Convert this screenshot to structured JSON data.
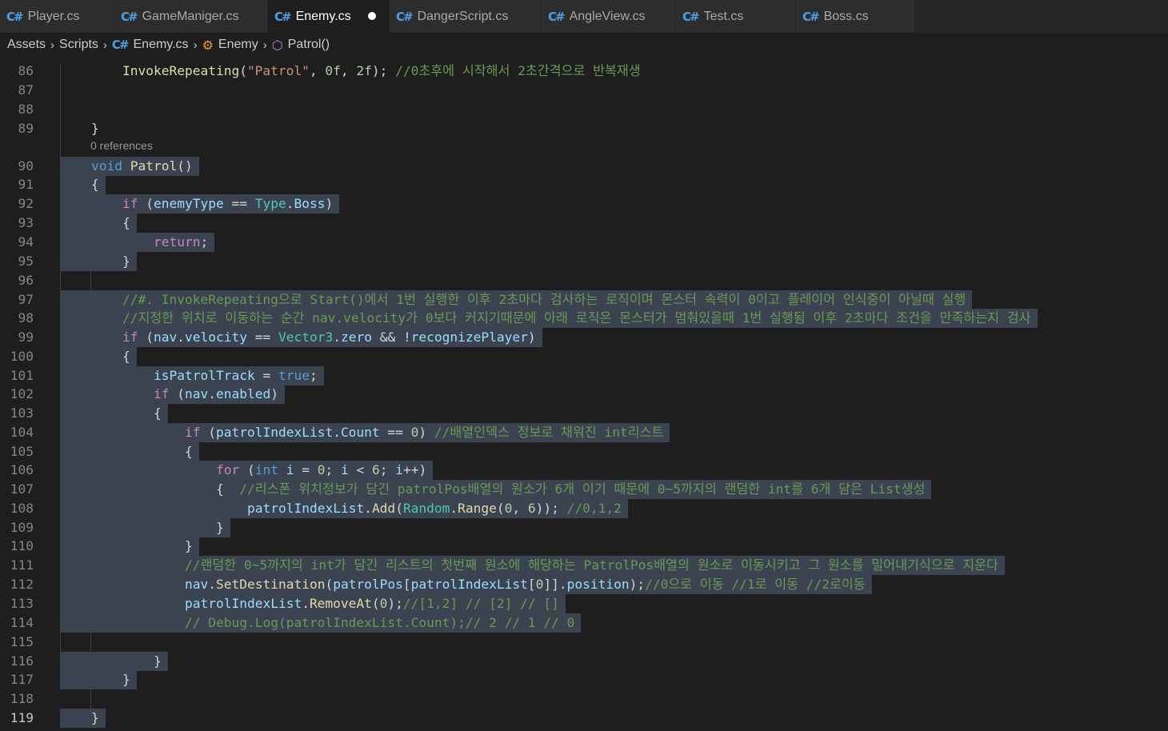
{
  "tabs": [
    {
      "label": "Player.cs",
      "active": false
    },
    {
      "label": "GameManiger.cs",
      "active": false
    },
    {
      "label": "Enemy.cs",
      "active": true,
      "modified": true
    },
    {
      "label": "DangerScript.cs",
      "active": false
    },
    {
      "label": "AngleView.cs",
      "active": false
    },
    {
      "label": "Test.cs",
      "active": false
    },
    {
      "label": "Boss.cs",
      "active": false
    }
  ],
  "breadcrumb": {
    "folder1": "Assets",
    "folder2": "Scripts",
    "file": "Enemy.cs",
    "class": "Enemy",
    "method": "Patrol()"
  },
  "codelens": "0 references",
  "colors": {
    "background": "#1e1e1e",
    "keyword": "#569cd6",
    "control": "#c586c0",
    "function": "#dcdcaa",
    "string": "#ce9178",
    "number": "#b5cea8",
    "variable": "#9cdcfe",
    "type": "#4ec9b0",
    "comment": "#6a9955",
    "selection": "#3b4350"
  },
  "lines": [
    {
      "n": "86",
      "code": "        InvokeRepeating(\"Patrol\", 0f, 2f); //0초후에 시작해서 2초간격으로 반복재생"
    },
    {
      "n": "87",
      "code": ""
    },
    {
      "n": "88",
      "code": ""
    },
    {
      "n": "89",
      "code": "    }"
    },
    {
      "n": "90",
      "code": "    void Patrol()"
    },
    {
      "n": "91",
      "code": "    {"
    },
    {
      "n": "92",
      "code": "        if (enemyType == Type.Boss)"
    },
    {
      "n": "93",
      "code": "        {"
    },
    {
      "n": "94",
      "code": "            return;"
    },
    {
      "n": "95",
      "code": "        }"
    },
    {
      "n": "96",
      "code": ""
    },
    {
      "n": "97",
      "code": "        //#. InvokeRepeating으로 Start()에서 1번 실행한 이후 2초마다 검사하는 로직이며 몬스터 속력이 0이고 플레이어 인식중이 아닐때 실행"
    },
    {
      "n": "98",
      "code": "        //지정한 위치로 이동하는 순간 nav.velocity가 0보다 커지기때문에 아래 로직은 몬스터가 멈춰있을때 1번 실행됨 이후 2초마다 조건을 만족하는지 검사"
    },
    {
      "n": "99",
      "code": "        if (nav.velocity == Vector3.zero && !recognizePlayer)"
    },
    {
      "n": "100",
      "code": "        {"
    },
    {
      "n": "101",
      "code": "            isPatrolTrack = true;"
    },
    {
      "n": "102",
      "code": "            if (nav.enabled)"
    },
    {
      "n": "103",
      "code": "            {"
    },
    {
      "n": "104",
      "code": "                if (patrolIndexList.Count == 0) //배열인덱스 정보로 채워진 int리스트"
    },
    {
      "n": "105",
      "code": "                {"
    },
    {
      "n": "106",
      "code": "                    for (int i = 0; i < 6; i++)"
    },
    {
      "n": "107",
      "code": "                    {  //리스폰 위치정보가 담긴 patrolPos배열의 원소가 6개 이기 때문에 0~5까지의 랜덤한 int를 6개 담은 List생성"
    },
    {
      "n": "108",
      "code": "                        patrolIndexList.Add(Random.Range(0, 6)); //0,1,2"
    },
    {
      "n": "109",
      "code": "                    }"
    },
    {
      "n": "110",
      "code": "                }"
    },
    {
      "n": "111",
      "code": "                //랜덤한 0~5까지의 int가 담긴 리스트의 첫번째 원소에 해당하는 PatrolPos배열의 원소로 이동시키고 그 원소를 밀어내기식으로 지운다"
    },
    {
      "n": "112",
      "code": "                nav.SetDestination(patrolPos[patrolIndexList[0]].position);//0으로 이동 //1로 이동 //2로이동"
    },
    {
      "n": "113",
      "code": "                patrolIndexList.RemoveAt(0);//[1,2] // [2] // []"
    },
    {
      "n": "114",
      "code": "                // Debug.Log(patrolIndexList.Count);// 2 // 1 // 0"
    },
    {
      "n": "115",
      "code": ""
    },
    {
      "n": "116",
      "code": "            }"
    },
    {
      "n": "117",
      "code": "        }"
    },
    {
      "n": "118",
      "code": ""
    },
    {
      "n": "119",
      "code": "    }"
    }
  ]
}
